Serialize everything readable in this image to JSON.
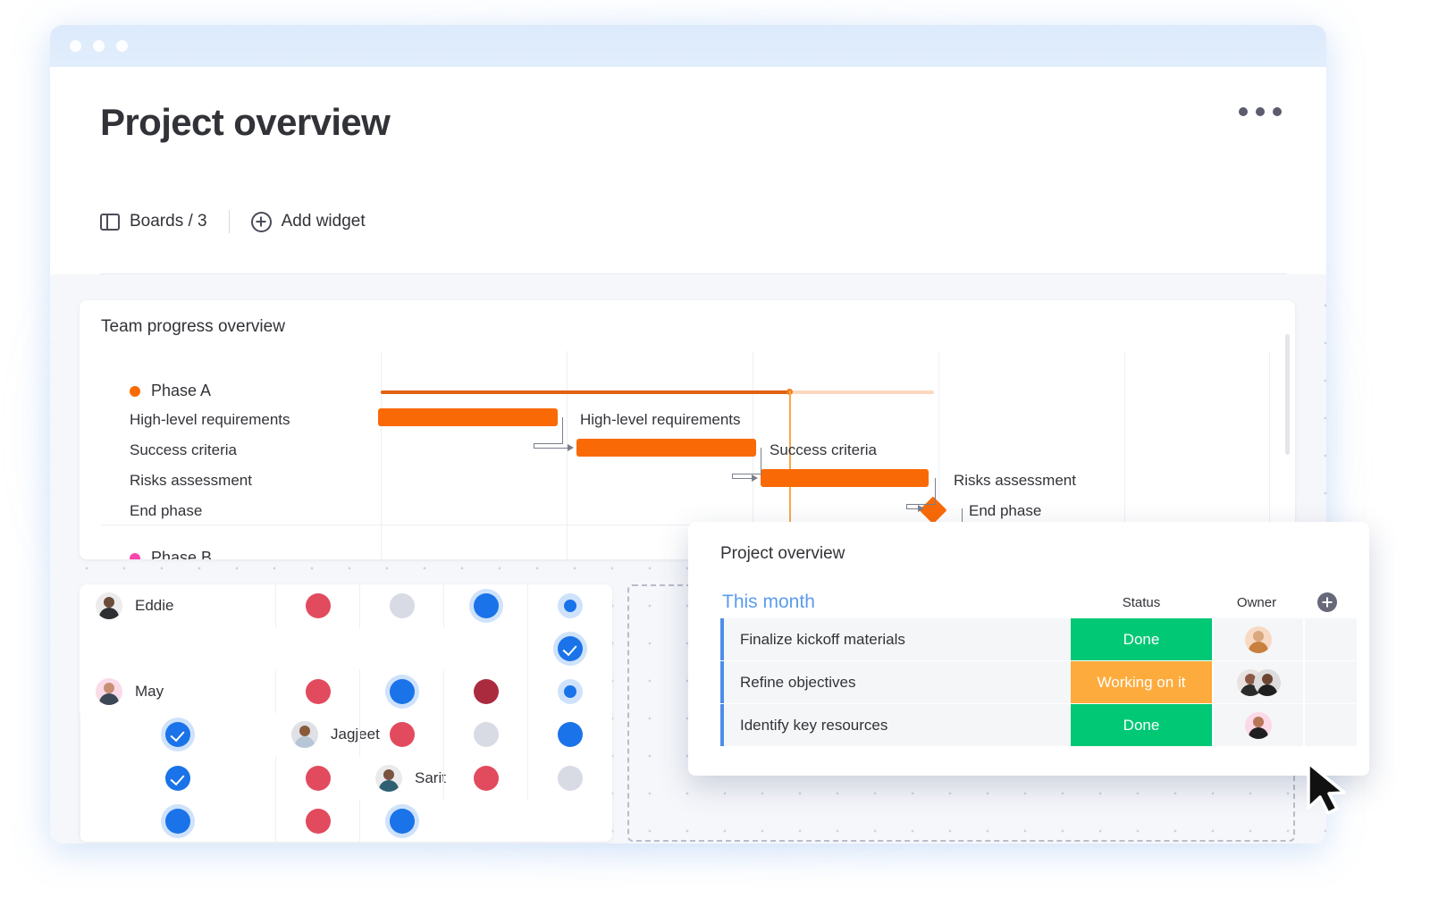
{
  "window": {
    "traffic_lights": [
      "close",
      "minimize",
      "maximize"
    ]
  },
  "header": {
    "title": "Project overview",
    "kebab_label": "More options",
    "toolbar": {
      "boards_label": "Boards / 3",
      "boards_icon": "board-icon",
      "add_widget_label": "Add widget",
      "add_widget_icon": "plus-circle-icon"
    }
  },
  "gantt": {
    "title": "Team progress overview",
    "phases": [
      {
        "name": "Phase A",
        "color": "#f96a06"
      },
      {
        "name": "Phase B",
        "color": "#f845ab"
      }
    ],
    "tasks": [
      {
        "label": "High-level requirements",
        "bar_label": "High-level requirements",
        "type": "bar",
        "start_pct": 0.0,
        "end_pct": 19.2
      },
      {
        "label": "Success criteria",
        "bar_label": "Success criteria",
        "type": "bar",
        "start_pct": 21.8,
        "end_pct": 40.7
      },
      {
        "label": "Risks assessment",
        "bar_label": "Risks assessment",
        "type": "bar",
        "start_pct": 42.4,
        "end_pct": 61.6
      },
      {
        "label": "End phase",
        "bar_label": "End phase",
        "type": "milestone",
        "start_pct": 65.5,
        "end_pct": 65.5
      }
    ],
    "summary_bar_color": "#e06212",
    "summary_bar_future_color": "#fbd9c0",
    "today_marker_color": "#f9a64a",
    "bar_color": "#f96a06",
    "connector_color": "#7a7f8c"
  },
  "status_grid": {
    "rows": [
      {
        "name": "Eddie",
        "avatar_bg": "#ececec",
        "skin": "#6b4b3a",
        "shirt": "#2d2f33",
        "cells": [
          "red",
          "empty",
          "blue",
          "ring",
          "checkring"
        ]
      },
      {
        "name": "May",
        "avatar_bg": "#fbdbe8",
        "skin": "#c98f73",
        "shirt": "#3c4856",
        "cells": [
          "red",
          "blue",
          "darkred",
          "ring",
          "checkring"
        ]
      },
      {
        "name": "Jagjeet",
        "avatar_bg": "#dfe1e6",
        "skin": "#8a5a3b",
        "shirt": "#b7c6d6",
        "cells": [
          "red",
          "empty",
          "blue",
          "check",
          "red"
        ]
      },
      {
        "name": "Sarit",
        "avatar_bg": "#eaeaec",
        "skin": "#7a5240",
        "shirt": "#2f5f72",
        "cells": [
          "red",
          "empty",
          "blue",
          "red",
          "blue"
        ]
      }
    ]
  },
  "card": {
    "title": "Project overview",
    "group_label": "This month",
    "columns": {
      "status": "Status",
      "owner": "Owner"
    },
    "add_column_icon": "plus-circle-icon",
    "rows": [
      {
        "name": "Finalize kickoff materials",
        "status": "Done",
        "status_color": "#00c875",
        "owners": [
          {
            "bg": "#f7d9c4",
            "skin": "#d9a87e",
            "shirt": "#c8803f"
          }
        ]
      },
      {
        "name": "Refine objectives",
        "status": "Working on it",
        "status_color": "#fdab3d",
        "owners": [
          {
            "bg": "#e8e3e0",
            "skin": "#8a5a44",
            "shirt": "#2b2b2b"
          },
          {
            "bg": "#dcdcdc",
            "skin": "#6b4530",
            "shirt": "#1f1f1f"
          }
        ]
      },
      {
        "name": "Identify key resources",
        "status": "Done",
        "status_color": "#00c875",
        "owners": [
          {
            "bg": "#fbd9e7",
            "skin": "#b8765a",
            "shirt": "#1f1f22"
          }
        ]
      }
    ]
  },
  "cursor": {
    "icon": "arrow-cursor"
  },
  "colors": {
    "accent_orange": "#f96a06",
    "accent_pink": "#f845ab",
    "status_done": "#00c875",
    "status_working": "#fdab3d",
    "blue": "#1a73e8",
    "red": "#e24a5e"
  }
}
